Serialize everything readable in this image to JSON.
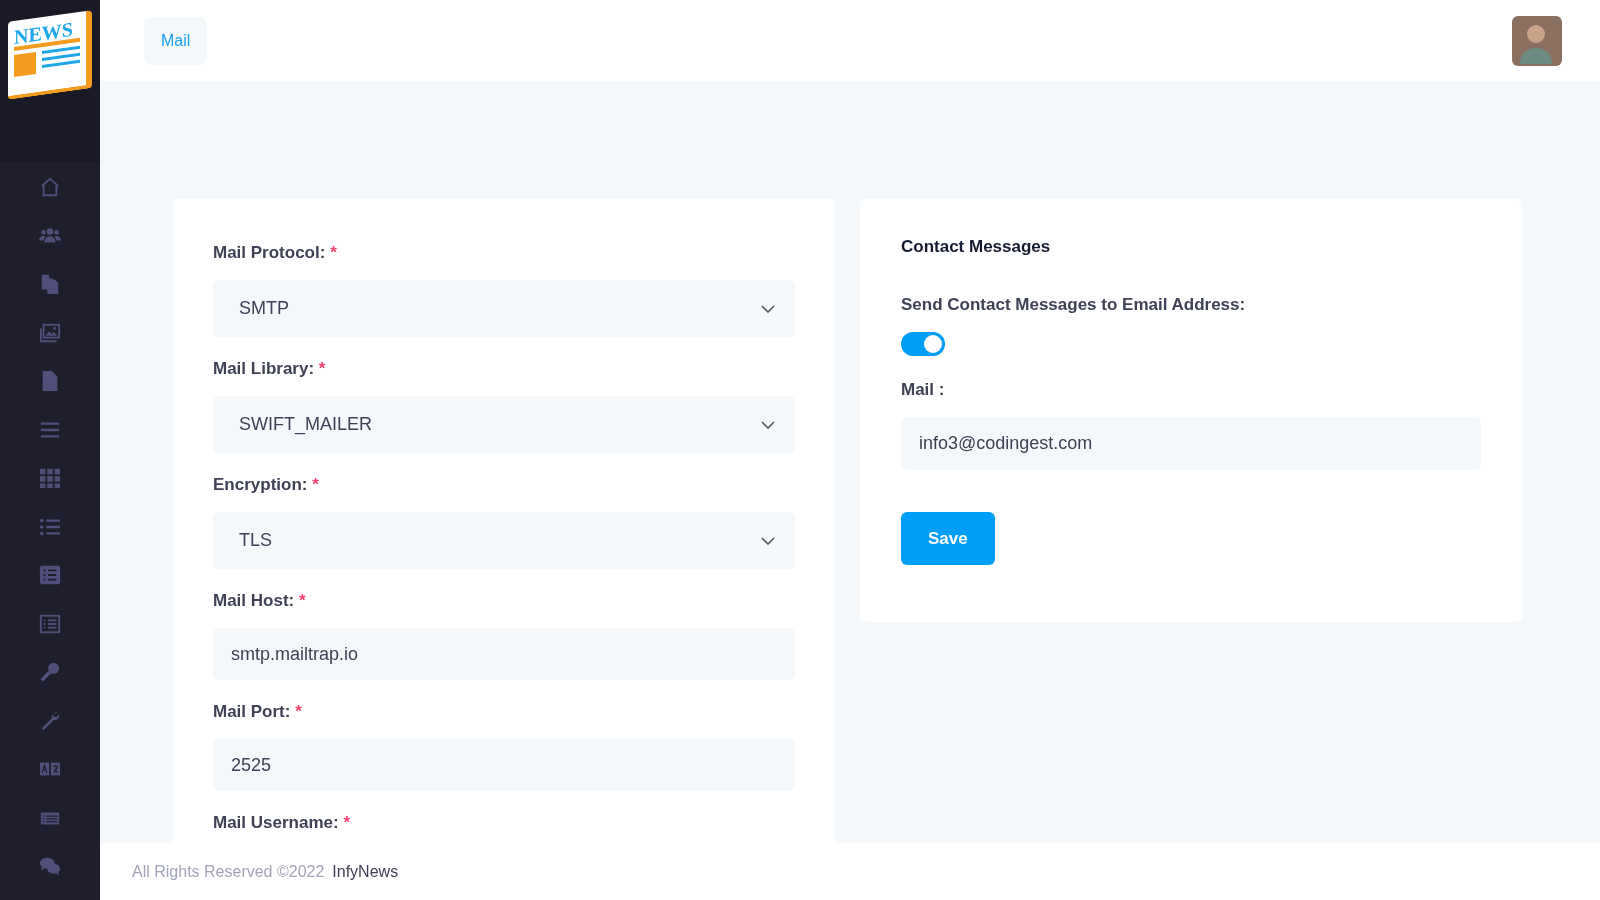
{
  "logo": {
    "text": "NEWS"
  },
  "header": {
    "breadcrumb": "Mail"
  },
  "mail_settings": {
    "fields": [
      {
        "kind": "select",
        "label": "Mail Protocol:",
        "required_mark": "*",
        "value": "SMTP"
      },
      {
        "kind": "select",
        "label": "Mail Library:",
        "required_mark": "*",
        "value": "SWIFT_MAILER"
      },
      {
        "kind": "select",
        "label": "Encryption:",
        "required_mark": "*",
        "value": "TLS"
      },
      {
        "kind": "input",
        "label": "Mail Host:",
        "required_mark": "*",
        "value": "smtp.mailtrap.io"
      },
      {
        "kind": "input",
        "label": "Mail Port:",
        "required_mark": "*",
        "value": "2525"
      },
      {
        "kind": "input",
        "label": "Mail Username:",
        "required_mark": "*"
      }
    ]
  },
  "contact_messages": {
    "title": "Contact Messages",
    "toggle_label": "Send Contact Messages to Email Address:",
    "toggle_on": true,
    "mail_label": "Mail :",
    "mail_value": "info3@codingest.com",
    "save_button": "Save"
  },
  "footer": {
    "text": "All Rights Reserved ©2022",
    "link": "InfyNews"
  }
}
